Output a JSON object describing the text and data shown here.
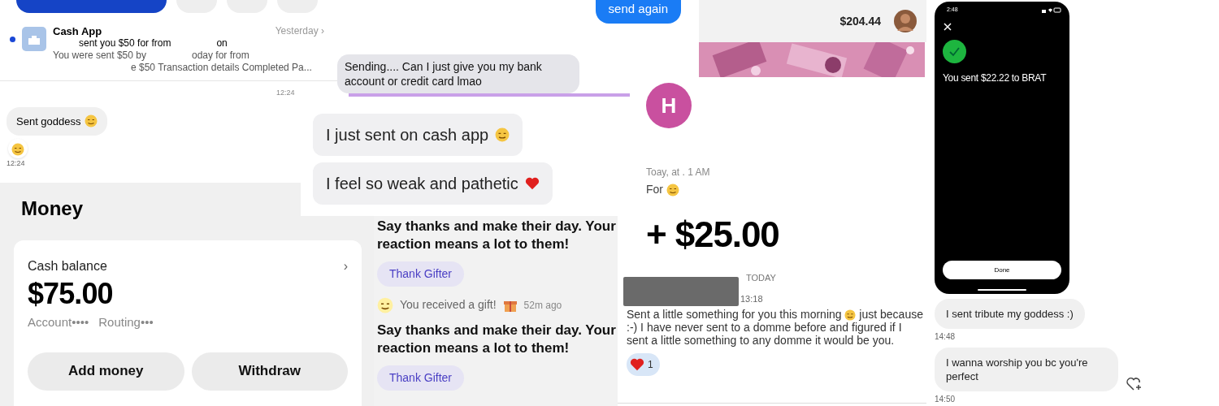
{
  "inbox": {
    "sender": "Cash App",
    "time": "Yesterday",
    "chevron": "›",
    "subject": "sent you $50 for from",
    "subject_tail": "on",
    "preview_1": "You were sent $50 by",
    "preview_1_tail": "oday for from",
    "preview_2": "e $50 Transaction details Completed Pa...",
    "unread": true,
    "stamp": "12:24"
  },
  "chat_a": {
    "messages": [
      {
        "text": "Sent goddess"
      }
    ],
    "stamp": "12:24"
  },
  "chat_b": {
    "outgoing": "send again",
    "incoming": "Sending.... Can I just give you my bank account or credit card lmao"
  },
  "chat_c": {
    "messages": [
      {
        "text": "I just sent on cash app",
        "kind": "face"
      },
      {
        "text": "I feel so weak and pathetic",
        "kind": "heart"
      }
    ]
  },
  "payment": {
    "balance": "$204.44",
    "initial": "H",
    "date": "Toay, at . 1 AM",
    "note": "For",
    "amount": "+ $25.00"
  },
  "money": {
    "title": "Money",
    "card_label": "Cash balance",
    "chevron": "›",
    "amount": "$75.00",
    "account": "Account",
    "account_mask": "••••",
    "routing": "Routing",
    "routing_mask": "•••",
    "buttons": [
      "Add money",
      "Withdraw"
    ]
  },
  "gifts": {
    "items": [
      {
        "kind": "prompt",
        "text": "Say thanks and make their day. Your reaction means a lot to them!",
        "button": "Thank Gifter"
      },
      {
        "kind": "notice",
        "text": "You received a gift!",
        "time": "52m ago"
      },
      {
        "kind": "prompt",
        "text": "Say thanks and make their day. Your reaction means a lot to them!",
        "button": "Thank Gifter"
      }
    ]
  },
  "dm": {
    "day": "TODAY",
    "time": "13:18",
    "message": "Sent a little something for you this morning",
    "message_tail": "just because :-) I have never sent to a domme before and figured if I sent a little something to any domme it would be you.",
    "reaction_count": "1"
  },
  "phone": {
    "clock": "2:48",
    "confirmation": "You sent $22.22 to BRAT",
    "button": "Done"
  },
  "chat_d": {
    "messages": [
      {
        "text": "I sent tribute my goddess :)",
        "time": "14:48"
      },
      {
        "text": "I wanna worship you bc you're perfect",
        "time": "14:50"
      }
    ]
  }
}
